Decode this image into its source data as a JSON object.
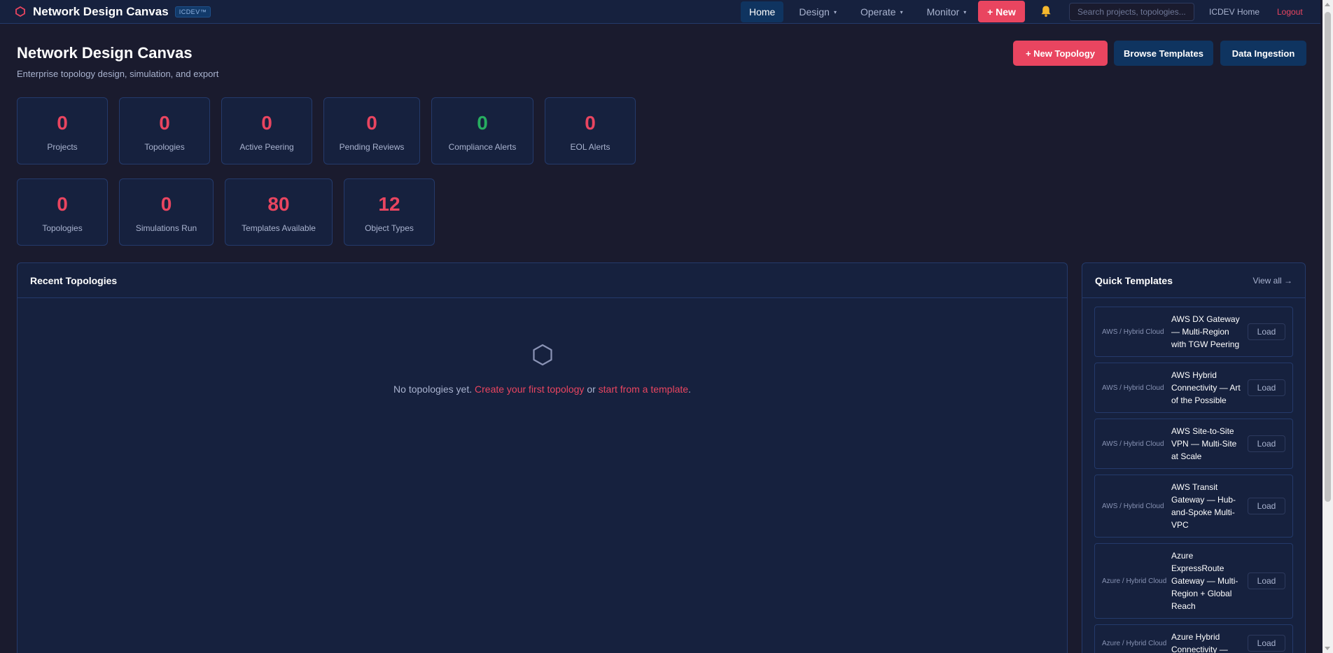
{
  "topbar": {
    "title": "Network Design Canvas",
    "badge": "ICDEV™",
    "nav": [
      {
        "label": "Home"
      },
      {
        "label": "Design",
        "caret": "▾"
      },
      {
        "label": "Operate",
        "caret": "▾"
      },
      {
        "label": "Monitor",
        "caret": "▾"
      }
    ],
    "new_label": "+ New",
    "search_placeholder": "Search projects, topologies...",
    "home_link": "ICDEV Home",
    "logout_link": "Logout"
  },
  "header": {
    "title": "Network Design Canvas",
    "subtitle": "Enterprise topology design, simulation, and export",
    "new_topology": "+ New Topology",
    "browse_templates": "Browse Templates",
    "data_ingestion": "Data Ingestion"
  },
  "stats_row1": [
    {
      "value": "0",
      "label": "Projects"
    },
    {
      "value": "0",
      "label": "Topologies"
    },
    {
      "value": "0",
      "label": "Active Peering"
    },
    {
      "value": "0",
      "label": "Pending Reviews"
    },
    {
      "value": "0",
      "label": "Compliance Alerts"
    },
    {
      "value": "0",
      "label": "EOL Alerts"
    }
  ],
  "stats_row2": [
    {
      "value": "0",
      "label": "Topologies"
    },
    {
      "value": "0",
      "label": "Simulations Run"
    },
    {
      "value": "80",
      "label": "Templates Available"
    },
    {
      "value": "12",
      "label": "Object Types"
    }
  ],
  "recent": {
    "title": "Recent Topologies",
    "empty_prefix": "No topologies yet.",
    "empty_link1": "Create your first topology",
    "empty_middle": "or",
    "empty_link2": "start from a template",
    "empty_suffix": "."
  },
  "quick": {
    "title": "Quick Templates",
    "view_all": "View all →",
    "load_label": "Load",
    "templates": [
      {
        "category": "AWS / Hybrid Cloud",
        "name": "AWS DX Gateway — Multi-Region with TGW Peering"
      },
      {
        "category": "AWS / Hybrid Cloud",
        "name": "AWS Hybrid Connectivity — Art of the Possible"
      },
      {
        "category": "AWS / Hybrid Cloud",
        "name": "AWS Site-to-Site VPN — Multi-Site at Scale"
      },
      {
        "category": "AWS / Hybrid Cloud",
        "name": "AWS Transit Gateway — Hub-and-Spoke Multi-VPC"
      },
      {
        "category": "Azure / Hybrid Cloud",
        "name": "Azure ExpressRoute Gateway — Multi-Region + Global Reach"
      },
      {
        "category": "Azure / Hybrid Cloud",
        "name": "Azure Hybrid Connectivity —"
      }
    ]
  },
  "colors": {
    "accent": "#e94560",
    "success": "#27ae60",
    "panel": "#16213e",
    "background": "#1a1b2e"
  }
}
